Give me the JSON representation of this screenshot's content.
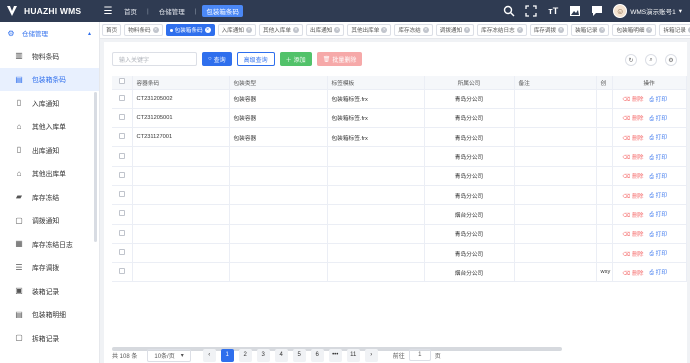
{
  "app": {
    "name": "HUAZHI WMS"
  },
  "breadcrumb": [
    "首页",
    "仓储管理",
    "包装箱条码"
  ],
  "user": {
    "name": "WMS演示账号1"
  },
  "sidebar": {
    "group": "仓储管理",
    "items": [
      {
        "label": "物料条码",
        "icon": "barcode-icon",
        "glyph": "▥"
      },
      {
        "label": "包装箱条码",
        "icon": "box-icon",
        "glyph": "▤",
        "active": true
      },
      {
        "label": "入库通知",
        "icon": "document-icon",
        "glyph": "▯"
      },
      {
        "label": "其他入库单",
        "icon": "warehouse-in-icon",
        "glyph": "⌂"
      },
      {
        "label": "出库通知",
        "icon": "document-out-icon",
        "glyph": "▯"
      },
      {
        "label": "其他出库单",
        "icon": "warehouse-out-icon",
        "glyph": "⌂"
      },
      {
        "label": "库存冻结",
        "icon": "lock-icon",
        "glyph": "▰"
      },
      {
        "label": "调拨通知",
        "icon": "transfer-icon",
        "glyph": "▢"
      },
      {
        "label": "库存冻结日志",
        "icon": "log-icon",
        "glyph": "▦"
      },
      {
        "label": "库存调拨",
        "icon": "list-icon",
        "glyph": "☰"
      },
      {
        "label": "装箱记录",
        "icon": "record-icon",
        "glyph": "▣"
      },
      {
        "label": "包装箱明细",
        "icon": "detail-icon",
        "glyph": "▤"
      },
      {
        "label": "拆箱记录",
        "icon": "unpack-icon",
        "glyph": "▢"
      }
    ]
  },
  "tabs": [
    {
      "label": "首页",
      "closable": false
    },
    {
      "label": "物料条码",
      "closable": true
    },
    {
      "label": "包装箱条码",
      "closable": true,
      "active": true
    },
    {
      "label": "入库通知",
      "closable": true
    },
    {
      "label": "其他入库单",
      "closable": true
    },
    {
      "label": "出库通知",
      "closable": true
    },
    {
      "label": "其他出库单",
      "closable": true
    },
    {
      "label": "库存冻结",
      "closable": true
    },
    {
      "label": "调拨通知",
      "closable": true
    },
    {
      "label": "库存冻结日志",
      "closable": true
    },
    {
      "label": "库存调拨",
      "closable": true
    },
    {
      "label": "装箱记录",
      "closable": true
    },
    {
      "label": "包装箱明细",
      "closable": true
    },
    {
      "label": "拆箱记录",
      "closable": true
    }
  ],
  "toolbar": {
    "search_placeholder": "输入关键字",
    "query": "查询",
    "advanced": "高级查询",
    "add": "添加",
    "batch_delete": "批量删除"
  },
  "table": {
    "columns": [
      "容器条码",
      "包装类型",
      "标签模板",
      "所属公司",
      "备注",
      "创",
      "操作"
    ],
    "rows": [
      {
        "code": "CT231205002",
        "type": "包装容器",
        "template": "包装箱标签.frx",
        "company": "青岛分公司",
        "remark": "",
        "creator": ""
      },
      {
        "code": "CT231205001",
        "type": "包装容器",
        "template": "包装箱标签.frx",
        "company": "青岛分公司",
        "remark": "",
        "creator": ""
      },
      {
        "code": "CT231127001",
        "type": "包装容器",
        "template": "包装箱标签.frx",
        "company": "青岛分公司",
        "remark": "",
        "creator": ""
      },
      {
        "code": "",
        "type": "",
        "template": "",
        "company": "青岛分公司",
        "remark": "",
        "creator": ""
      },
      {
        "code": "",
        "type": "",
        "template": "",
        "company": "青岛分公司",
        "remark": "",
        "creator": ""
      },
      {
        "code": "",
        "type": "",
        "template": "",
        "company": "青岛分公司",
        "remark": "",
        "creator": ""
      },
      {
        "code": "",
        "type": "",
        "template": "",
        "company": "烟台分公司",
        "remark": "",
        "creator": ""
      },
      {
        "code": "",
        "type": "",
        "template": "",
        "company": "青岛分公司",
        "remark": "",
        "creator": ""
      },
      {
        "code": "",
        "type": "",
        "template": "",
        "company": "青岛分公司",
        "remark": "",
        "creator": ""
      },
      {
        "code": "",
        "type": "",
        "template": "",
        "company": "烟台分公司",
        "remark": "",
        "creator": "wsy"
      }
    ],
    "delete_label": "删除",
    "print_label": "打印"
  },
  "pagination": {
    "total": "共 108 条",
    "page_size": "10条/页",
    "pages": [
      "1",
      "2",
      "3",
      "4",
      "5",
      "6",
      "•••",
      "11"
    ],
    "current": "1",
    "goto_label": "前往",
    "goto_value": "1",
    "page_suffix": "页"
  }
}
